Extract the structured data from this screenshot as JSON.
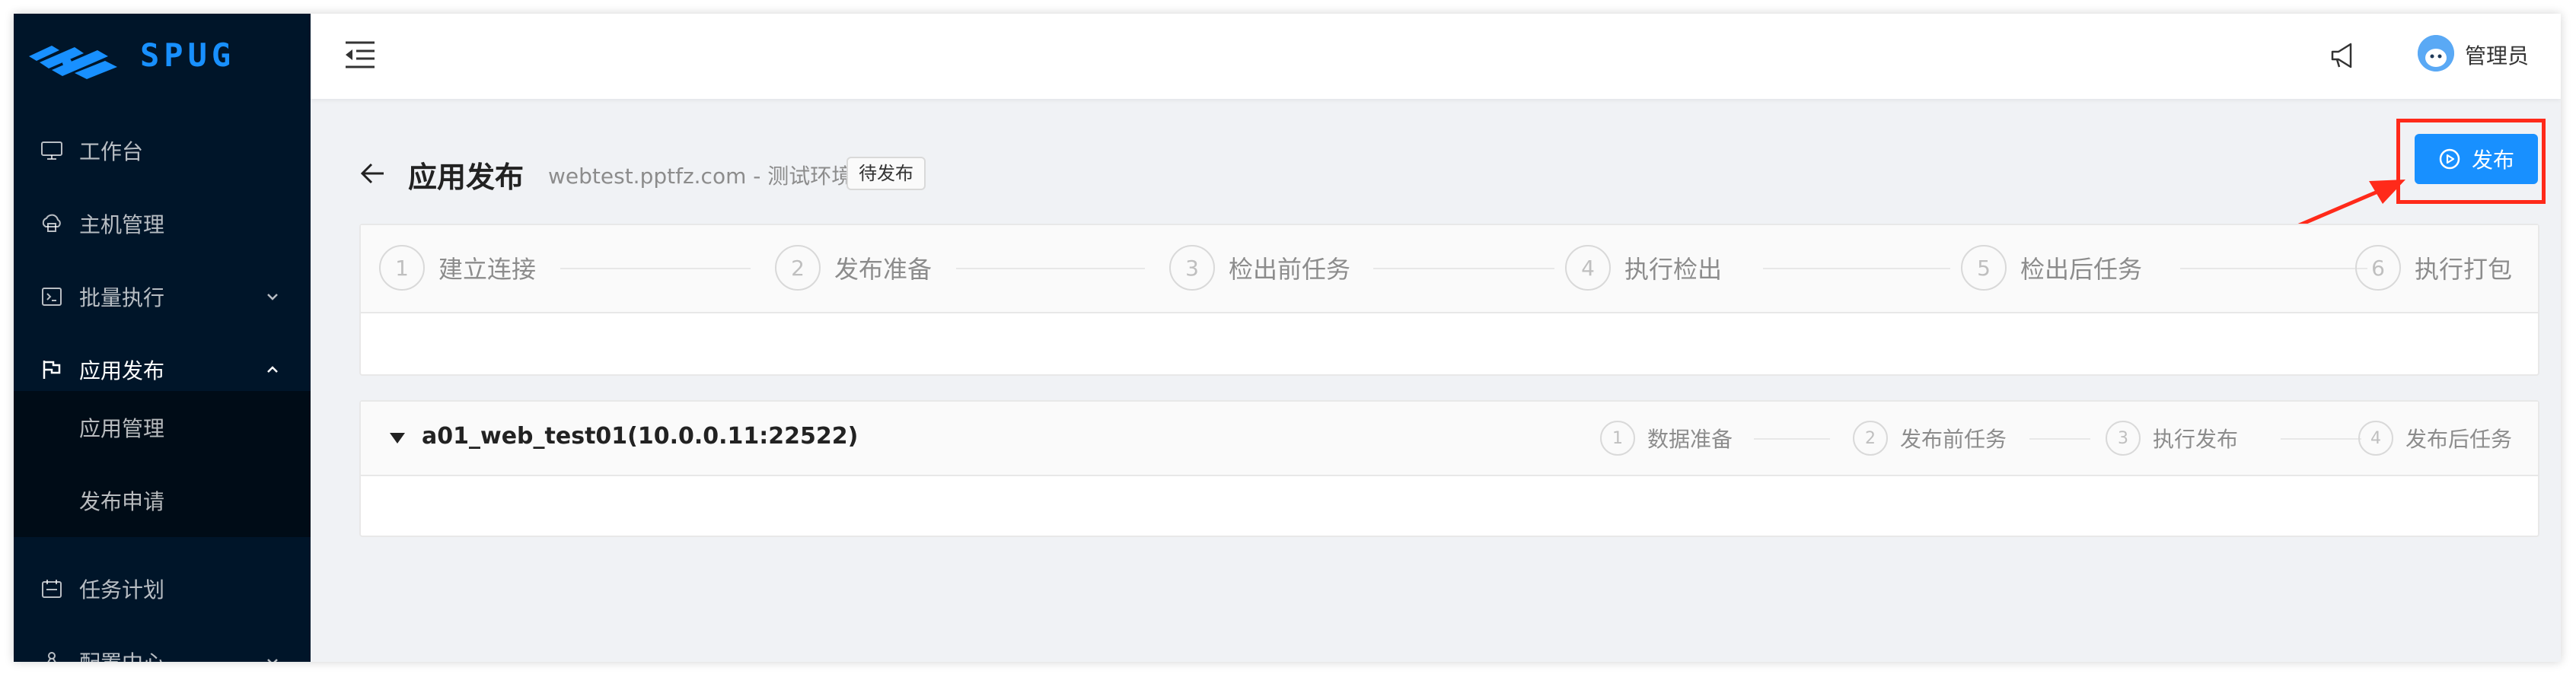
{
  "brand": {
    "name": "SPUG",
    "color": "#1890ff"
  },
  "sidebar": {
    "items": [
      {
        "label": "工作台",
        "icon": "desktop-icon"
      },
      {
        "label": "主机管理",
        "icon": "cloud-server-icon"
      },
      {
        "label": "批量执行",
        "icon": "code-icon",
        "expanded": false
      },
      {
        "label": "应用发布",
        "icon": "flag-icon",
        "expanded": true
      },
      {
        "label": "任务计划",
        "icon": "schedule-icon"
      },
      {
        "label": "配置中心",
        "icon": "deployment-icon",
        "expanded": false
      }
    ],
    "submenu": [
      {
        "label": "应用管理"
      },
      {
        "label": "发布申请"
      }
    ]
  },
  "header": {
    "user_name": "管理员"
  },
  "page": {
    "title": "应用发布",
    "subtitle": "webtest.pptfz.com - 测试环境",
    "status_tag": "待发布",
    "publish_label": "发布",
    "accent_color": "#1890ff",
    "highlight_color": "#ff2a1a"
  },
  "steps": [
    {
      "num": "1",
      "label": "建立连接"
    },
    {
      "num": "2",
      "label": "发布准备"
    },
    {
      "num": "3",
      "label": "检出前任务"
    },
    {
      "num": "4",
      "label": "执行检出"
    },
    {
      "num": "5",
      "label": "检出后任务"
    },
    {
      "num": "6",
      "label": "执行打包"
    }
  ],
  "host": {
    "title": "a01_web_test01(10.0.0.11:22522)",
    "steps": [
      {
        "num": "1",
        "label": "数据准备"
      },
      {
        "num": "2",
        "label": "发布前任务"
      },
      {
        "num": "3",
        "label": "执行发布"
      },
      {
        "num": "4",
        "label": "发布后任务"
      }
    ]
  }
}
